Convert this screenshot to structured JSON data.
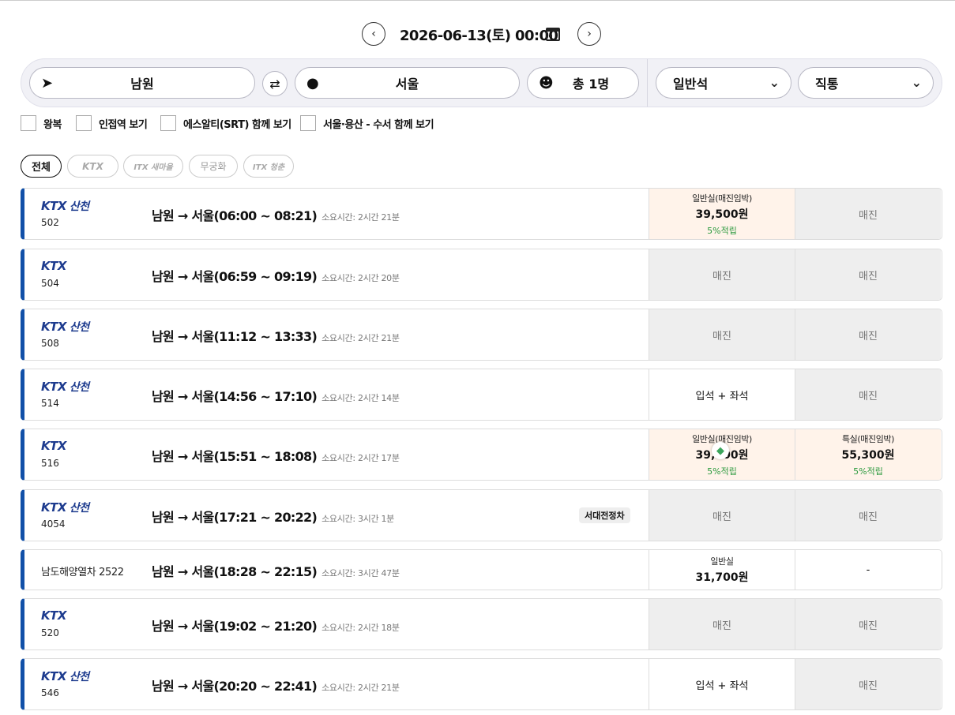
{
  "date": {
    "label": "2026-06-13(토) 00:00",
    "prev_icon": "chevron-left-icon",
    "next_icon": "chevron-right-icon",
    "calendar_icon": "calendar-icon"
  },
  "search": {
    "origin": "남원",
    "destination": "서울",
    "passengers": "총 1명",
    "seat_class": "일반석",
    "route_type": "직통"
  },
  "options": [
    "왕복",
    "인접역 보기",
    "에스알티(SRT) 함께 보기",
    "서울·용산 - 수서 함께 보기"
  ],
  "filters": {
    "all": "전체",
    "ktx": "KTX",
    "itx_saemaeul": "ITX 새마을",
    "mugunghwa": "무궁화",
    "itx_cheongchun": "ITX 청춘"
  },
  "colors": {
    "accent": "#1150a8",
    "sold_bg": "#eeeeee",
    "avail_bg": "#fff3ea",
    "points": "#2c9a3f"
  },
  "trains": [
    {
      "brand": "KTX",
      "sub": "산천",
      "number": "502",
      "route": "남원 → 서울(06:00 ~ 08:21)",
      "duration": "소요시간: 2시간 21분",
      "tag": "",
      "seat1": {
        "state": "avail",
        "cls": "일반실(매진임박)",
        "price": "39,500원",
        "points": "5%적립"
      },
      "seat2": {
        "state": "sold",
        "text": "매진"
      }
    },
    {
      "brand": "KTX",
      "sub": "",
      "number": "504",
      "route": "남원 → 서울(06:59 ~ 09:19)",
      "duration": "소요시간: 2시간 20분",
      "tag": "",
      "seat1": {
        "state": "sold",
        "text": "매진"
      },
      "seat2": {
        "state": "sold",
        "text": "매진"
      }
    },
    {
      "brand": "KTX",
      "sub": "산천",
      "number": "508",
      "route": "남원 → 서울(11:12 ~ 13:33)",
      "duration": "소요시간: 2시간 21분",
      "tag": "",
      "seat1": {
        "state": "sold",
        "text": "매진"
      },
      "seat2": {
        "state": "sold",
        "text": "매진"
      }
    },
    {
      "brand": "KTX",
      "sub": "산천",
      "number": "514",
      "route": "남원 → 서울(14:56 ~ 17:10)",
      "duration": "소요시간: 2시간 14분",
      "tag": "",
      "seat1": {
        "state": "plain",
        "text": "입석 + 좌석"
      },
      "seat2": {
        "state": "sold",
        "text": "매진"
      }
    },
    {
      "brand": "KTX",
      "sub": "",
      "number": "516",
      "route": "남원 → 서울(15:51 ~ 18:08)",
      "duration": "소요시간: 2시간 17분",
      "tag": "",
      "seat1": {
        "state": "avail",
        "cls": "일반실(매진임박)",
        "price": "39,500원",
        "points": "5%적립"
      },
      "seat2": {
        "state": "avail",
        "cls": "특실(매진임박)",
        "price": "55,300원",
        "points": "5%적립"
      }
    },
    {
      "brand": "KTX",
      "sub": "산천",
      "number": "4054",
      "route": "남원 → 서울(17:21 ~ 20:22)",
      "duration": "소요시간: 3시간 1분",
      "tag": "서대전정차",
      "seat1": {
        "state": "sold",
        "text": "매진"
      },
      "seat2": {
        "state": "sold",
        "text": "매진"
      }
    },
    {
      "brand": "",
      "sub": "",
      "name": "남도해양열차 2522",
      "number": "",
      "route": "남원 → 서울(18:28 ~ 22:15)",
      "duration": "소요시간: 3시간 47분",
      "tag": "",
      "seat1": {
        "state": "plainprice",
        "cls": "일반실",
        "price": "31,700원"
      },
      "seat2": {
        "state": "plain",
        "text": "-"
      }
    },
    {
      "brand": "KTX",
      "sub": "",
      "number": "520",
      "route": "남원 → 서울(19:02 ~ 21:20)",
      "duration": "소요시간: 2시간 18분",
      "tag": "",
      "seat1": {
        "state": "sold",
        "text": "매진"
      },
      "seat2": {
        "state": "sold",
        "text": "매진"
      }
    },
    {
      "brand": "KTX",
      "sub": "산천",
      "number": "546",
      "route": "남원 → 서울(20:20 ~ 22:41)",
      "duration": "소요시간: 2시간 21분",
      "tag": "",
      "seat1": {
        "state": "plain",
        "text": "입석 + 좌석"
      },
      "seat2": {
        "state": "sold",
        "text": "매진"
      }
    }
  ]
}
